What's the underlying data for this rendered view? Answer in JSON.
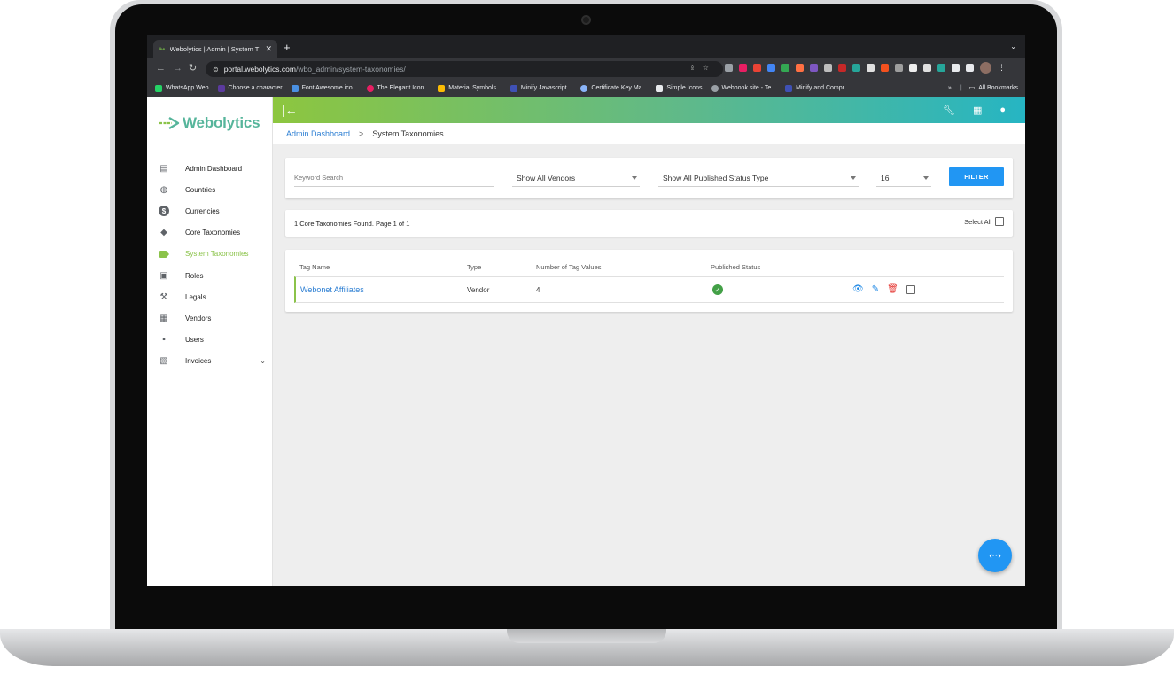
{
  "browser": {
    "tab_title": "Webolytics | Admin | System T",
    "url_host": "portal.webolytics.com",
    "url_path": "/wbo_admin/system-taxonomies/",
    "bookmarks": [
      {
        "label": "WhatsApp Web",
        "color": "#25d366"
      },
      {
        "label": "Choose a character",
        "color": "#5b3a9e"
      },
      {
        "label": "Font Awesome ico...",
        "color": "#4a90e2"
      },
      {
        "label": "The Elegant Icon...",
        "color": "#e91e63"
      },
      {
        "label": "Material Symbols...",
        "color": "#fbbc04"
      },
      {
        "label": "Minify Javascript...",
        "color": "#3f51b5"
      },
      {
        "label": "Certificate Key Ma...",
        "color": "#8ab4f8"
      },
      {
        "label": "Simple Icons",
        "color": "#e8eaed"
      },
      {
        "label": "Webhook.site - Te...",
        "color": "#9aa0a6"
      },
      {
        "label": "Minify and Compr...",
        "color": "#3f51b5"
      }
    ],
    "all_bookmarks": "All Bookmarks",
    "more": "»"
  },
  "app": {
    "brand": "Webolytics",
    "sidebar": [
      {
        "label": "Admin Dashboard",
        "icon": "dashboard-icon",
        "glyph": "▤"
      },
      {
        "label": "Countries",
        "icon": "globe-icon",
        "glyph": "◍"
      },
      {
        "label": "Currencies",
        "icon": "dollar-icon",
        "glyph": "$"
      },
      {
        "label": "Core Taxonomies",
        "icon": "tags-icon",
        "glyph": "◆"
      },
      {
        "label": "System Taxonomies",
        "icon": "label-icon",
        "glyph": "▬",
        "active": true
      },
      {
        "label": "Roles",
        "icon": "lock-icon",
        "glyph": "▣"
      },
      {
        "label": "Legals",
        "icon": "gavel-icon",
        "glyph": "⚒"
      },
      {
        "label": "Vendors",
        "icon": "building-icon",
        "glyph": "▦"
      },
      {
        "label": "Users",
        "icon": "users-folder-icon",
        "glyph": "▪"
      },
      {
        "label": "Invoices",
        "icon": "wallet-icon",
        "glyph": "▧",
        "expandable": true
      }
    ],
    "breadcrumb": {
      "parent": "Admin Dashboard",
      "separator": ">",
      "current": "System Taxonomies"
    },
    "filters": {
      "keyword_placeholder": "Keyword Search",
      "vendor": "Show All Vendors",
      "published": "Show All Published Status Type",
      "per_page": "16",
      "button": "FILTER"
    },
    "results": {
      "message": "1 Core Taxonomies Found. Page 1 of 1",
      "select_all": "Select All"
    },
    "table": {
      "headers": [
        "Tag Name",
        "Type",
        "Number of Tag Values",
        "Published Status"
      ],
      "rows": [
        {
          "name": "Webonet Affiliates",
          "type": "Vendor",
          "count": "4",
          "published": true
        }
      ]
    },
    "fab_label": "‹··›",
    "colors": {
      "accent_green": "#8bc34a",
      "link_blue": "#2d7fd3",
      "primary_blue": "#2196f3",
      "delete_red": "#e53935"
    }
  }
}
